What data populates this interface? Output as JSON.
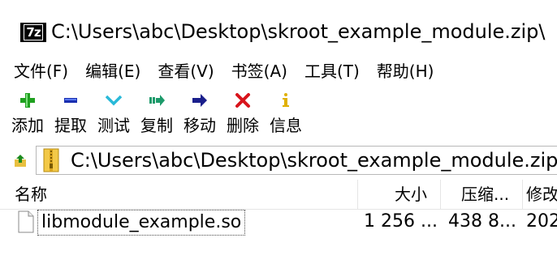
{
  "window": {
    "title": "C:\\Users\\abc\\Desktop\\skroot_example_module.zip\\",
    "app_icon_text": "7z"
  },
  "menu": [
    {
      "label": "文件(F)"
    },
    {
      "label": "编辑(E)"
    },
    {
      "label": "查看(V)"
    },
    {
      "label": "书签(A)"
    },
    {
      "label": "工具(T)"
    },
    {
      "label": "帮助(H)"
    }
  ],
  "toolbar": [
    {
      "label": "添加",
      "icon": "plus-icon",
      "color": "#1fa01f"
    },
    {
      "label": "提取",
      "icon": "minus-icon",
      "color": "#1a2fb0"
    },
    {
      "label": "测试",
      "icon": "check-chevron-icon",
      "color": "#29b9d8"
    },
    {
      "label": "复制",
      "icon": "copy-arrow-icon",
      "color": "#1c9a6a"
    },
    {
      "label": "移动",
      "icon": "move-arrow-icon",
      "color": "#1a1f8c"
    },
    {
      "label": "删除",
      "icon": "delete-x-icon",
      "color": "#d8141c"
    },
    {
      "label": "信息",
      "icon": "info-icon",
      "color": "#e0b000"
    }
  ],
  "address": {
    "path": "C:\\Users\\abc\\Desktop\\skroot_example_module.zip\\"
  },
  "list": {
    "columns": {
      "name": "名称",
      "size": "大小",
      "packed": "压缩...",
      "modified": "修改"
    },
    "rows": [
      {
        "name": "libmodule_example.so",
        "size": "1 256 ...",
        "packed": "438 8...",
        "modified": "202"
      }
    ]
  }
}
